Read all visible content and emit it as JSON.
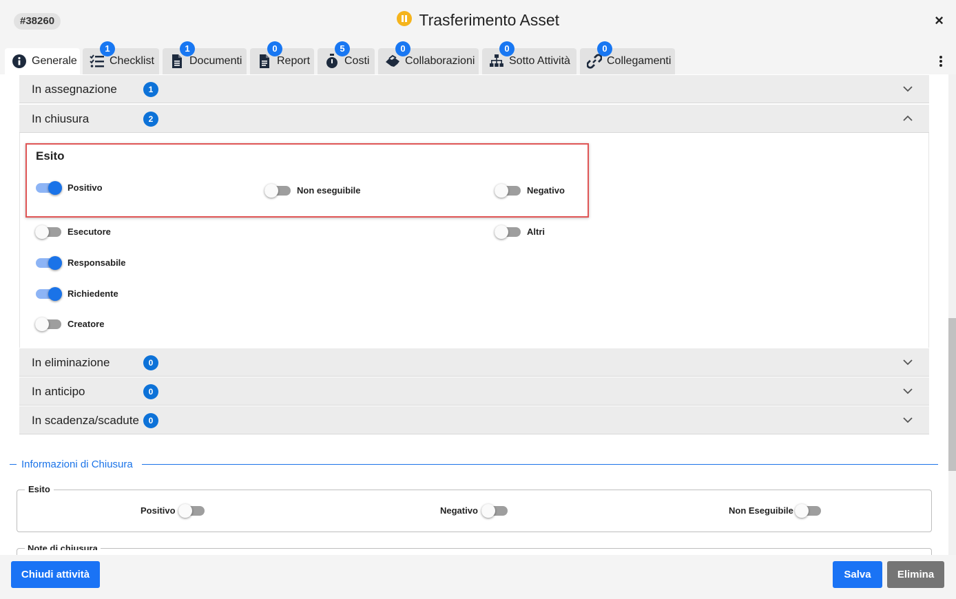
{
  "header": {
    "ticket_id": "#38260",
    "title": "Trasferimento Asset",
    "status_icon": "pause-circle-icon",
    "status_color": "#f5b41c",
    "close_label": "×"
  },
  "tabs": [
    {
      "label": "Generale",
      "icon": "info-icon",
      "badge": null,
      "active": true
    },
    {
      "label": "Checklist",
      "icon": "checklist-icon",
      "badge": "1"
    },
    {
      "label": "Documenti",
      "icon": "document-icon",
      "badge": "1"
    },
    {
      "label": "Report",
      "icon": "report-icon",
      "badge": "0"
    },
    {
      "label": "Costi",
      "icon": "stopwatch-icon",
      "badge": "5"
    },
    {
      "label": "Collaborazioni",
      "icon": "handshake-icon",
      "badge": "0"
    },
    {
      "label": "Sotto Attività",
      "icon": "sitemap-icon",
      "badge": "0"
    },
    {
      "label": "Collegamenti",
      "icon": "link-icon",
      "badge": "0"
    }
  ],
  "accordion": {
    "in_assegnazione": {
      "label": "In assegnazione",
      "count": "1",
      "expanded": false
    },
    "in_chiusura": {
      "label": "In chiusura",
      "count": "2",
      "expanded": true
    },
    "in_eliminazione": {
      "label": "In eliminazione",
      "count": "0",
      "expanded": false
    },
    "in_anticipo": {
      "label": "In anticipo",
      "count": "0",
      "expanded": false
    },
    "in_scadenza": {
      "label": "In scadenza/scadute",
      "count": "0",
      "expanded": false
    }
  },
  "chiusura_panel": {
    "esito_title": "Esito",
    "esito_toggles": [
      {
        "label": "Positivo",
        "on": true
      },
      {
        "label": "Non eseguibile",
        "on": false
      },
      {
        "label": "Negativo",
        "on": false
      }
    ],
    "recipients": [
      {
        "label": "Esecutore",
        "on": false
      },
      {
        "label": "Altri",
        "on": false
      },
      {
        "label": "Responsabile",
        "on": true
      },
      {
        "label": "Richiedente",
        "on": true
      },
      {
        "label": "Creatore",
        "on": false
      }
    ]
  },
  "closing_info": {
    "section_title": "Informazioni di Chiusura",
    "esito_legend": "Esito",
    "options": [
      {
        "label": "Positivo",
        "on": false
      },
      {
        "label": "Negativo",
        "on": false
      },
      {
        "label": "Non Eseguibile",
        "on": false
      }
    ],
    "notes_legend": "Note di chiusura"
  },
  "footer": {
    "close_activity": "Chiudi attività",
    "save": "Salva",
    "delete": "Elimina"
  },
  "colors": {
    "accent": "#1a73e8",
    "badge": "#0d72d8",
    "highlight_border": "#e05555"
  }
}
